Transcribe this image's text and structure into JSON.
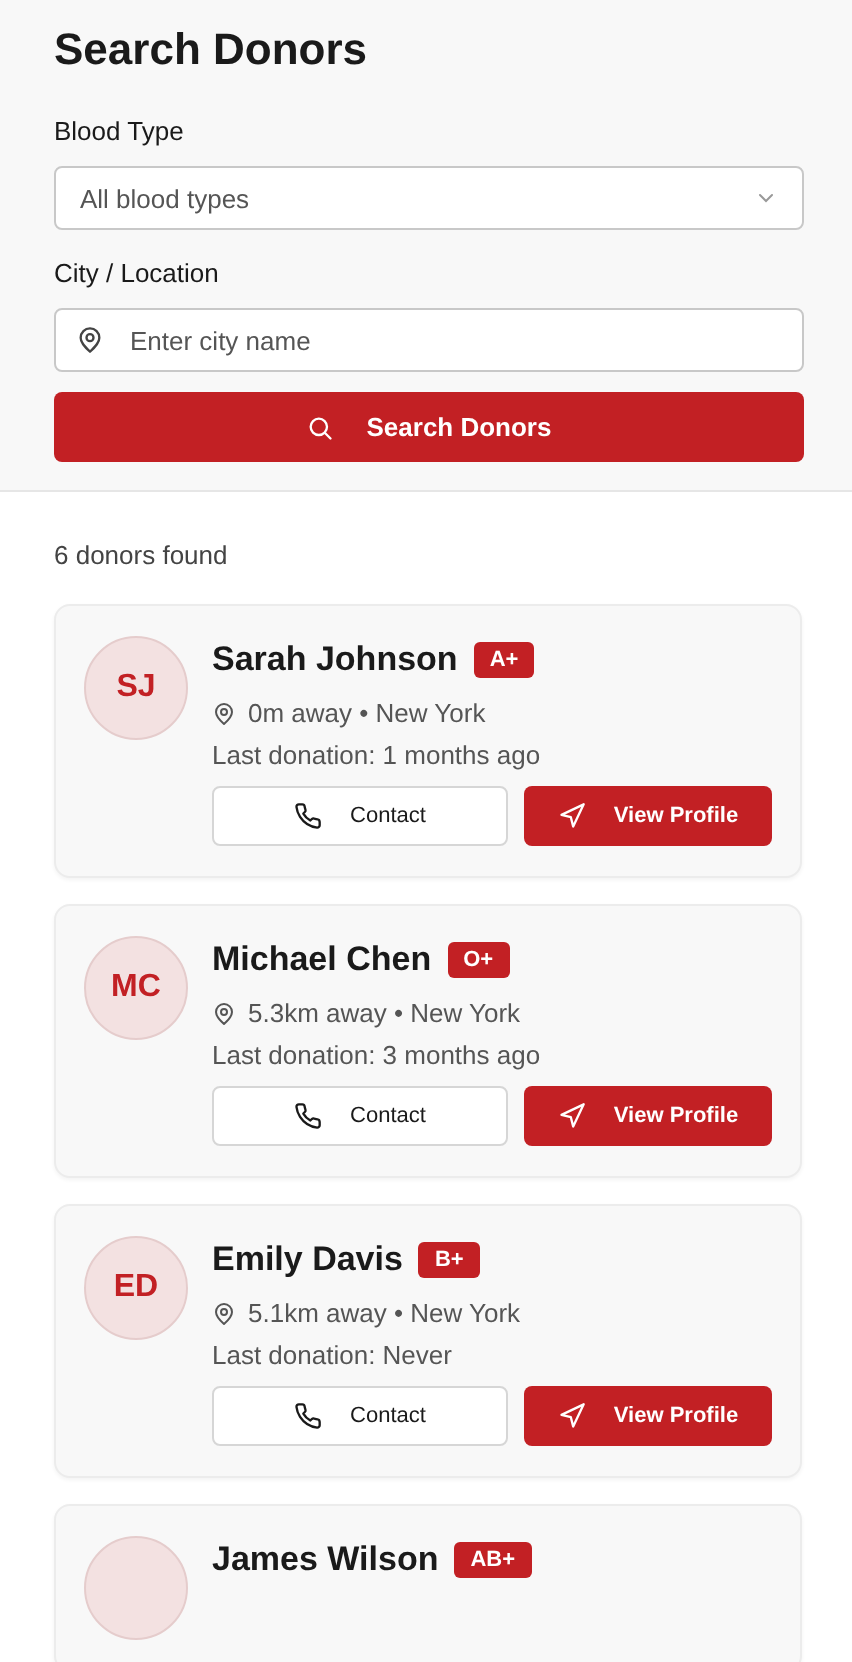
{
  "title": "Search Donors",
  "blood_type": {
    "label": "Blood Type",
    "placeholder": "All blood types"
  },
  "city": {
    "label": "City / Location",
    "placeholder": "Enter city name"
  },
  "search_button": "Search Donors",
  "result_count": "6 donors found",
  "donors": [
    {
      "initials": "SJ",
      "name": "Sarah Johnson",
      "blood_type": "A+",
      "location": "0m away • New York",
      "last_donation": "Last donation: 1 months ago",
      "contact": "Contact",
      "view": "View Profile"
    },
    {
      "initials": "MC",
      "name": "Michael Chen",
      "blood_type": "O+",
      "location": "5.3km away • New York",
      "last_donation": "Last donation: 3 months ago",
      "contact": "Contact",
      "view": "View Profile"
    },
    {
      "initials": "ED",
      "name": "Emily Davis",
      "blood_type": "B+",
      "location": "5.1km away • New York",
      "last_donation": "Last donation: Never",
      "contact": "Contact",
      "view": "View Profile"
    },
    {
      "name": "James Wilson",
      "blood_type": "AB+"
    }
  ]
}
